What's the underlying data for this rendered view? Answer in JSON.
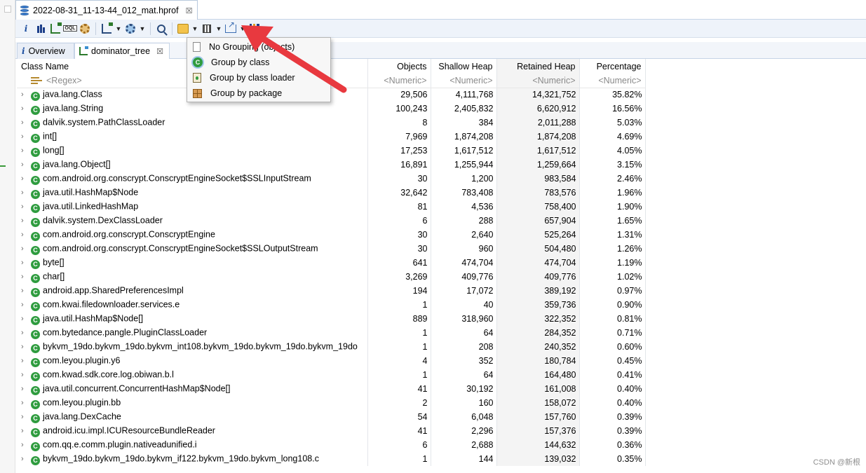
{
  "editor_tab": {
    "title": "2022-08-31_11-13-44_012_mat.hprof",
    "close": "☒"
  },
  "view_tabs": [
    {
      "label": "Overview"
    },
    {
      "label": "dominator_tree",
      "close": "☒"
    }
  ],
  "table": {
    "headers": [
      "Class Name",
      "Objects",
      "Shallow Heap",
      "Retained Heap",
      "Percentage"
    ],
    "filters": [
      "<Regex>",
      "<Numeric>",
      "<Numeric>",
      "<Numeric>",
      "<Numeric>"
    ],
    "rows": [
      {
        "name": "java.lang.Class",
        "objects": "29,506",
        "shallow": "4,111,768",
        "retained": "14,321,752",
        "pct": "35.82%"
      },
      {
        "name": "java.lang.String",
        "objects": "100,243",
        "shallow": "2,405,832",
        "retained": "6,620,912",
        "pct": "16.56%"
      },
      {
        "name": "dalvik.system.PathClassLoader",
        "objects": "8",
        "shallow": "384",
        "retained": "2,011,288",
        "pct": "5.03%"
      },
      {
        "name": "int[]",
        "objects": "7,969",
        "shallow": "1,874,208",
        "retained": "1,874,208",
        "pct": "4.69%"
      },
      {
        "name": "long[]",
        "objects": "17,253",
        "shallow": "1,617,512",
        "retained": "1,617,512",
        "pct": "4.05%"
      },
      {
        "name": "java.lang.Object[]",
        "objects": "16,891",
        "shallow": "1,255,944",
        "retained": "1,259,664",
        "pct": "3.15%"
      },
      {
        "name": "com.android.org.conscrypt.ConscryptEngineSocket$SSLInputStream",
        "objects": "30",
        "shallow": "1,200",
        "retained": "983,584",
        "pct": "2.46%"
      },
      {
        "name": "java.util.HashMap$Node",
        "objects": "32,642",
        "shallow": "783,408",
        "retained": "783,576",
        "pct": "1.96%"
      },
      {
        "name": "java.util.LinkedHashMap",
        "objects": "81",
        "shallow": "4,536",
        "retained": "758,400",
        "pct": "1.90%"
      },
      {
        "name": "dalvik.system.DexClassLoader",
        "objects": "6",
        "shallow": "288",
        "retained": "657,904",
        "pct": "1.65%"
      },
      {
        "name": "com.android.org.conscrypt.ConscryptEngine",
        "objects": "30",
        "shallow": "2,640",
        "retained": "525,264",
        "pct": "1.31%"
      },
      {
        "name": "com.android.org.conscrypt.ConscryptEngineSocket$SSLOutputStream",
        "objects": "30",
        "shallow": "960",
        "retained": "504,480",
        "pct": "1.26%"
      },
      {
        "name": "byte[]",
        "objects": "641",
        "shallow": "474,704",
        "retained": "474,704",
        "pct": "1.19%"
      },
      {
        "name": "char[]",
        "objects": "3,269",
        "shallow": "409,776",
        "retained": "409,776",
        "pct": "1.02%"
      },
      {
        "name": "android.app.SharedPreferencesImpl",
        "objects": "194",
        "shallow": "17,072",
        "retained": "389,192",
        "pct": "0.97%"
      },
      {
        "name": "com.kwai.filedownloader.services.e",
        "objects": "1",
        "shallow": "40",
        "retained": "359,736",
        "pct": "0.90%"
      },
      {
        "name": "java.util.HashMap$Node[]",
        "objects": "889",
        "shallow": "318,960",
        "retained": "322,352",
        "pct": "0.81%"
      },
      {
        "name": "com.bytedance.pangle.PluginClassLoader",
        "objects": "1",
        "shallow": "64",
        "retained": "284,352",
        "pct": "0.71%"
      },
      {
        "name": "bykvm_19do.bykvm_19do.bykvm_int108.bykvm_19do.bykvm_19do.bykvm_19do",
        "objects": "1",
        "shallow": "208",
        "retained": "240,352",
        "pct": "0.60%"
      },
      {
        "name": "com.leyou.plugin.y6",
        "objects": "4",
        "shallow": "352",
        "retained": "180,784",
        "pct": "0.45%"
      },
      {
        "name": "com.kwad.sdk.core.log.obiwan.b.l",
        "objects": "1",
        "shallow": "64",
        "retained": "164,480",
        "pct": "0.41%"
      },
      {
        "name": "java.util.concurrent.ConcurrentHashMap$Node[]",
        "objects": "41",
        "shallow": "30,192",
        "retained": "161,008",
        "pct": "0.40%"
      },
      {
        "name": "com.leyou.plugin.bb",
        "objects": "2",
        "shallow": "160",
        "retained": "158,072",
        "pct": "0.40%"
      },
      {
        "name": "java.lang.DexCache",
        "objects": "54",
        "shallow": "6,048",
        "retained": "157,760",
        "pct": "0.39%"
      },
      {
        "name": "android.icu.impl.ICUResourceBundleReader",
        "objects": "41",
        "shallow": "2,296",
        "retained": "157,376",
        "pct": "0.39%"
      },
      {
        "name": "com.qq.e.comm.plugin.nativeadunified.i",
        "objects": "6",
        "shallow": "2,688",
        "retained": "144,632",
        "pct": "0.36%"
      },
      {
        "name": "bykvm_19do.bykvm_19do.bykvm_if122.bykvm_19do.bykvm_long108.c",
        "objects": "1",
        "shallow": "144",
        "retained": "139,032",
        "pct": "0.35%"
      }
    ]
  },
  "menu": {
    "items": [
      {
        "label": "No Grouping (objects)",
        "icon": "document-icon"
      },
      {
        "label": "Group by class",
        "icon": "class-icon"
      },
      {
        "label": "Group by class loader",
        "icon": "class-loader-icon"
      },
      {
        "label": "Group by package",
        "icon": "package-icon"
      }
    ]
  },
  "watermark": "CSDN @新根",
  "colors": {
    "annotation_arrow": "#e8393f",
    "class_icon": "#2f9c3f"
  }
}
